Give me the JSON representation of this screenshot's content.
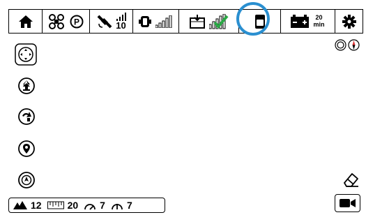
{
  "status_bar": {
    "gps_satellites": "10",
    "battery_time_value": "20",
    "battery_time_unit": "min",
    "parking_label": "P"
  },
  "bottom_stats": {
    "altitude": "12",
    "distance": "20",
    "speed_h": "7",
    "speed_v": "7"
  },
  "colors": {
    "highlight": "#2a8fd0",
    "status_ok": "#2aa845"
  }
}
